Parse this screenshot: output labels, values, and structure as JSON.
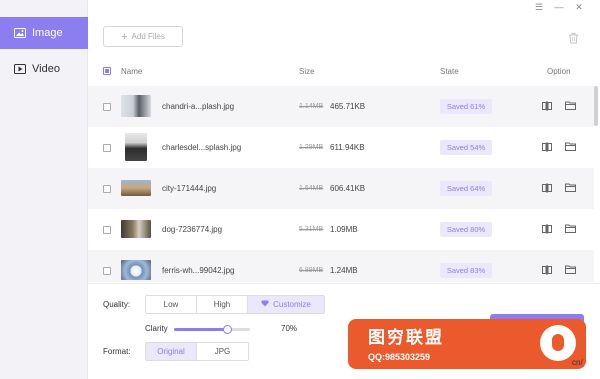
{
  "sidebar": {
    "items": [
      {
        "label": "Image",
        "icon": "image-icon",
        "active": true
      },
      {
        "label": "Video",
        "icon": "video-icon",
        "active": false
      }
    ]
  },
  "window": {
    "menu_glyph": "☰",
    "minimize_glyph": "—",
    "close_glyph": "✕"
  },
  "toolbar": {
    "add_files_label": "Add Files"
  },
  "table": {
    "headers": {
      "name": "Name",
      "size": "Size",
      "state": "State",
      "option": "Option"
    },
    "rows": [
      {
        "name": "chandri-a...plash.jpg",
        "old_size": "1.14MB",
        "new_size": "465.71KB",
        "state": "Saved 61%"
      },
      {
        "name": "charlesdel...splash.jpg",
        "old_size": "1.29MB",
        "new_size": "611.94KB",
        "state": "Saved 54%"
      },
      {
        "name": "city-171444.jpg",
        "old_size": "1.64MB",
        "new_size": "606.41KB",
        "state": "Saved 64%"
      },
      {
        "name": "dog-7236774.jpg",
        "old_size": "5.31MB",
        "new_size": "1.09MB",
        "state": "Saved 80%"
      },
      {
        "name": "ferris-wh...99042.jpg",
        "old_size": "6.89MB",
        "new_size": "1.24MB",
        "state": "Saved 83%"
      }
    ]
  },
  "settings": {
    "quality_label": "Quality:",
    "quality_options": [
      "Low",
      "High",
      "Customize"
    ],
    "quality_selected": "Customize",
    "clarity_label": "Clarity",
    "clarity_value": "70%",
    "clarity_level": 0.7,
    "format_label": "Format:",
    "format_options": [
      "Original",
      "JPG"
    ],
    "format_selected": "Original"
  },
  "watermark": {
    "title": "图穷联盟",
    "qq": "QQ:985303259",
    "suffix": "cn/"
  },
  "colors": {
    "accent": "#8c7df0",
    "badge_bg": "#ece8fb",
    "sidebar_bg": "#f2f2f7"
  }
}
